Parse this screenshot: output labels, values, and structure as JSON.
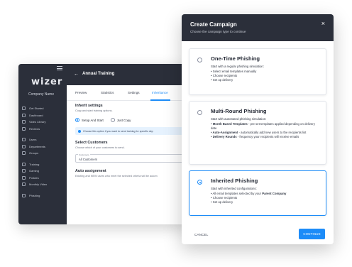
{
  "app": {
    "logo": "wizer",
    "company": "Company Name",
    "nav": [
      {
        "label": "Get Started",
        "icon": "rocket-icon"
      },
      {
        "label": "Dashboard",
        "icon": "dashboard-icon"
      },
      {
        "label": "Video Library",
        "icon": "video-icon"
      },
      {
        "label": "Reviews",
        "icon": "reviews-icon"
      },
      {
        "label": "Users",
        "icon": "user-icon"
      },
      {
        "label": "Departments",
        "icon": "departments-icon"
      },
      {
        "label": "Groups",
        "icon": "groups-icon"
      },
      {
        "label": "Training",
        "icon": "training-icon"
      },
      {
        "label": "Gaming",
        "icon": "gaming-icon"
      },
      {
        "label": "Policies",
        "icon": "policies-icon"
      },
      {
        "label": "Monthly Video",
        "icon": "calendar-icon"
      },
      {
        "label": "Phishing",
        "icon": "phishing-icon"
      }
    ],
    "back_glyph": "←",
    "title": "Annual Training",
    "tabs": [
      {
        "label": "Preview"
      },
      {
        "label": "Statistics"
      },
      {
        "label": "Settings"
      },
      {
        "label": "Inheritance"
      }
    ],
    "inherit": {
      "title": "Inherit settings",
      "subtitle": "Copy and start training options.",
      "option1": "Setup And Start",
      "option2": "Just Copy",
      "info": "Choose this option if you want to send training for specific dep"
    },
    "customers": {
      "title": "Select Customers",
      "subtitle": "Choose which of your customers to send.",
      "field_label": "Customers",
      "field_value": "All Customers"
    },
    "auto": {
      "title": "Auto assignment",
      "subtitle": "Existing and NEW users who meet the selected criteria will be autom"
    }
  },
  "modal": {
    "title": "Create Campaign",
    "subtitle": "Choose the campaign type to continue",
    "close_glyph": "×",
    "options": [
      {
        "title": "One-Time Phishing",
        "lead": "Start with a regular phishing simulation:",
        "bullets": [
          "• Select email templates manually",
          "• Choose recipients",
          "• Set up delivery"
        ],
        "selected": false
      },
      {
        "title": "Multi-Round Phishing",
        "lead": "Start with automated phishing simulation:",
        "bullets_rich": [
          {
            "bold": "• Month Based Templates",
            "rest": " - pre set templates applied depending on delivery date"
          },
          {
            "bold": "• Auto-Assignment",
            "rest": " - automatically add new users to the recipients list"
          },
          {
            "bold": "• Delivery Rounds",
            "rest": " - frequency your recipients will receive emails"
          }
        ],
        "selected": false
      },
      {
        "title": "Inherited Phishing",
        "lead": "Start with inherited configurations:",
        "bullet1_pre": "• All email templates selected by your ",
        "bullet1_bold": "Parent Company",
        "bullets": [
          "• Choose recipients",
          "• Set up delivery"
        ],
        "selected": true
      }
    ],
    "cancel": "CANCEL",
    "continue": "CONTINUE"
  },
  "colors": {
    "accent": "#1d8cf8",
    "dark": "#2b2f3a"
  }
}
